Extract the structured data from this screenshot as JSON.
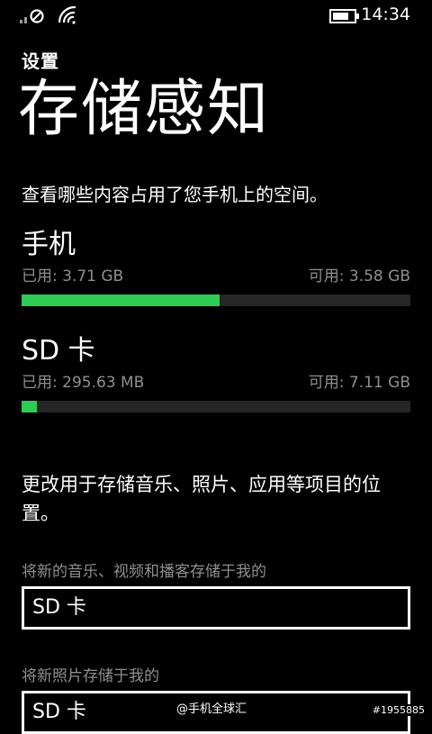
{
  "status_bar": {
    "time": "14:34",
    "icons": [
      "signal-disabled-icon",
      "wifi-icon",
      "battery-icon"
    ]
  },
  "header": {
    "app_title": "设置",
    "page_title": "存储感知"
  },
  "description": "查看哪些内容占用了您手机上的空间。",
  "storage": [
    {
      "name": "手机",
      "used": "已用: 3.71 GB",
      "free": "可用: 3.58 GB",
      "used_fraction": 0.51
    },
    {
      "name": "SD 卡",
      "used": "已用: 295.63 MB",
      "free": "可用: 7.11 GB",
      "used_fraction": 0.04
    }
  ],
  "section_text": "更改用于存储音乐、照片、应用等项目的位置。",
  "settings": [
    {
      "label": "将新的音乐、视频和播客存储于我的",
      "value": "SD 卡"
    },
    {
      "label": "将新照片存储于我的",
      "value": "SD 卡"
    }
  ],
  "watermark": {
    "text": "@手机全球汇",
    "id": "#1955885"
  },
  "colors": {
    "background": "#000000",
    "accent": "#2ecc52",
    "secondary_text": "#8f8f8f",
    "bar_track": "#262626"
  }
}
